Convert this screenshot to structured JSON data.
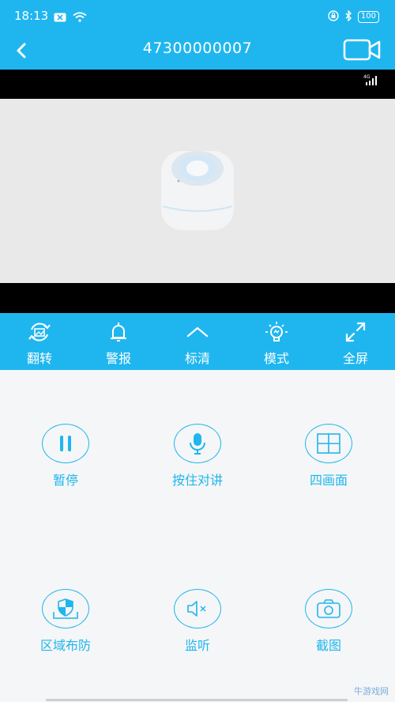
{
  "status_bar": {
    "time": "18:13",
    "battery": "100",
    "icons": [
      "notification-x-icon",
      "wifi-icon",
      "lock-icon",
      "bluetooth-icon",
      "battery-icon"
    ]
  },
  "header": {
    "title": "47300000007",
    "back_icon": "back-icon",
    "record_icon": "video-camera-icon"
  },
  "video": {
    "network": "4G"
  },
  "controls": [
    {
      "label": "翻转",
      "icon": "flip-icon"
    },
    {
      "label": "警报",
      "icon": "bell-icon"
    },
    {
      "label": "标清",
      "icon": "chevron-up-icon"
    },
    {
      "label": "模式",
      "icon": "bulb-icon"
    },
    {
      "label": "全屏",
      "icon": "fullscreen-icon"
    }
  ],
  "actions": [
    {
      "label": "暂停",
      "icon": "pause-icon"
    },
    {
      "label": "按住对讲",
      "icon": "microphone-icon"
    },
    {
      "label": "四画面",
      "icon": "grid-icon"
    },
    {
      "label": "区域布防",
      "icon": "shield-icon"
    },
    {
      "label": "监听",
      "icon": "speaker-mute-icon"
    },
    {
      "label": "截图",
      "icon": "camera-icon"
    }
  ],
  "colors": {
    "accent": "#1fb6ef",
    "background": "#f5f6f7",
    "video_bg": "#000000",
    "preview_bg": "#e9e9e9"
  },
  "watermark": "牛游戏网"
}
